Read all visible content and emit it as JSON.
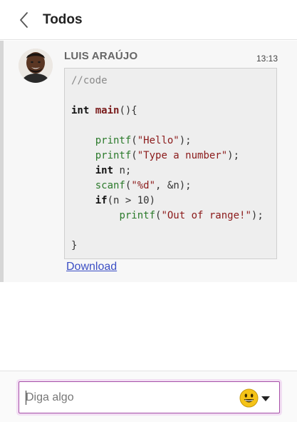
{
  "header": {
    "back_icon": "chevron-left-icon",
    "title": "Todos"
  },
  "message": {
    "author": "LUIS ARAÚJO",
    "time": "13:13",
    "avatar_icon": "user-avatar",
    "code_lines": [
      [
        {
          "t": "//code",
          "k": "comment"
        }
      ],
      [],
      [
        {
          "t": "int",
          "k": "kw"
        },
        {
          "t": " ",
          "k": "plain"
        },
        {
          "t": "main",
          "k": "fn"
        },
        {
          "t": "(){",
          "k": "plain"
        }
      ],
      [],
      [
        {
          "t": "    ",
          "k": "plain"
        },
        {
          "t": "printf",
          "k": "call"
        },
        {
          "t": "(",
          "k": "plain"
        },
        {
          "t": "\"Hello\"",
          "k": "str"
        },
        {
          "t": ");",
          "k": "plain"
        }
      ],
      [
        {
          "t": "    ",
          "k": "plain"
        },
        {
          "t": "printf",
          "k": "call"
        },
        {
          "t": "(",
          "k": "plain"
        },
        {
          "t": "\"Type a number\"",
          "k": "str"
        },
        {
          "t": ");",
          "k": "plain"
        }
      ],
      [
        {
          "t": "    ",
          "k": "plain"
        },
        {
          "t": "int",
          "k": "kw"
        },
        {
          "t": " n;",
          "k": "plain"
        }
      ],
      [
        {
          "t": "    ",
          "k": "plain"
        },
        {
          "t": "scanf",
          "k": "call"
        },
        {
          "t": "(",
          "k": "plain"
        },
        {
          "t": "\"%d\"",
          "k": "str"
        },
        {
          "t": ", &n);",
          "k": "plain"
        }
      ],
      [
        {
          "t": "    ",
          "k": "plain"
        },
        {
          "t": "if",
          "k": "kw"
        },
        {
          "t": "(n > 10)",
          "k": "plain"
        }
      ],
      [
        {
          "t": "        ",
          "k": "plain"
        },
        {
          "t": "printf",
          "k": "call"
        },
        {
          "t": "(",
          "k": "plain"
        },
        {
          "t": "\"Out of range!\"",
          "k": "str"
        },
        {
          "t": ");",
          "k": "plain"
        }
      ],
      [],
      [
        {
          "t": "}",
          "k": "plain"
        }
      ]
    ],
    "download_label": " Download "
  },
  "composer": {
    "placeholder": "Diga algo",
    "value": "",
    "emoji_icon": "smiley-emoji-icon",
    "dropdown_icon": "caret-down-icon"
  },
  "colors": {
    "accent_border": "#a64fa8",
    "link": "#3b4ec4",
    "emoji_yellow": "#f5c318"
  }
}
